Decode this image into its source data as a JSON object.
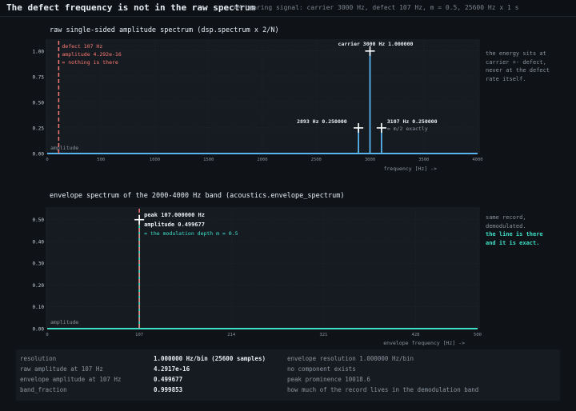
{
  "header": {
    "title": "The defect frequency is not in the raw spectrum",
    "subtitle": "AM bearing signal: carrier 3000 Hz, defect 107 Hz, m = 0.5, 25600 Hz x 1 s"
  },
  "panel1": {
    "title": "raw single-sided amplitude spectrum  (dsp.spectrum x 2/N)",
    "ylabel_inset": "amplitude",
    "xlabel": "frequency [Hz] ->",
    "defect_label": [
      "defect 107 Hz",
      "amplitude 4.292e-16",
      "= nothing is there"
    ],
    "carrier_label": "carrier 3000 Hz 1.000000",
    "left_sb_label": "2893 Hz 0.250000",
    "right_sb_label": "3107 Hz 0.250000",
    "right_sb_note": "= m/2 exactly",
    "side_note": [
      "the energy sits at",
      "carrier +- defect,",
      "never at the defect",
      "rate itself."
    ]
  },
  "panel2": {
    "title": "envelope spectrum of the 2000-4000 Hz band  (acoustics.envelope_spectrum)",
    "ylabel_inset": "amplitude",
    "xlabel": "envelope frequency [Hz] ->",
    "peak_label": [
      "peak 107.000000 Hz",
      "amplitude 0.499677"
    ],
    "peak_note": "= the modulation depth m = 0.5",
    "side_note": [
      "same record,",
      "demodulated."
    ],
    "side_note_hl": [
      "the line is there",
      "and it is exact."
    ]
  },
  "stats": [
    {
      "key": "resolution",
      "value": "1.000000 Hz/bin (25600 samples)",
      "note": "envelope resolution 1.000000 Hz/bin"
    },
    {
      "key": "raw amplitude at 107 Hz",
      "value": "4.2917e-16",
      "note": "no component exists"
    },
    {
      "key": "envelope amplitude at 107 Hz",
      "value": "0.499677",
      "note": "peak prominence 10018.6"
    },
    {
      "key": "band_fraction",
      "value": "0.999853",
      "note": "how much of the record lives in the demodulation band"
    }
  ],
  "colors": {
    "line": "#58b4f0",
    "env": "#3ee0c8",
    "marker": "#ff7b72",
    "white": "#ffffff",
    "grid": "#262c35"
  },
  "chart_data": [
    {
      "type": "line",
      "title": "raw single-sided amplitude spectrum  (dsp.spectrum x 2/N)",
      "xlabel": "frequency [Hz] ->",
      "ylabel": "amplitude",
      "xlim": [
        0,
        4000
      ],
      "ylim": [
        0,
        1.1
      ],
      "xticks": [
        0,
        500,
        1000,
        1500,
        2000,
        2500,
        3000,
        3500,
        4000
      ],
      "yticks": [
        0.0,
        0.25,
        0.5,
        0.75,
        1.0
      ],
      "peaks": [
        {
          "x": 2893,
          "y": 0.25
        },
        {
          "x": 3000,
          "y": 1.0
        },
        {
          "x": 3107,
          "y": 0.25
        }
      ],
      "defect_marker_x": 107,
      "defect_amplitude": "4.292e-16"
    },
    {
      "type": "line",
      "title": "envelope spectrum of the 2000-4000 Hz band  (acoustics.envelope_spectrum)",
      "xlabel": "envelope frequency [Hz] ->",
      "ylabel": "amplitude",
      "xlim": [
        0,
        500
      ],
      "ylim": [
        0,
        0.55
      ],
      "xticks": [
        0,
        107,
        214,
        321,
        428,
        500
      ],
      "yticks": [
        0.0,
        0.1,
        0.2,
        0.3,
        0.4,
        0.5
      ],
      "peaks": [
        {
          "x": 107,
          "y": 0.499677
        }
      ],
      "marker_x": 107
    }
  ]
}
